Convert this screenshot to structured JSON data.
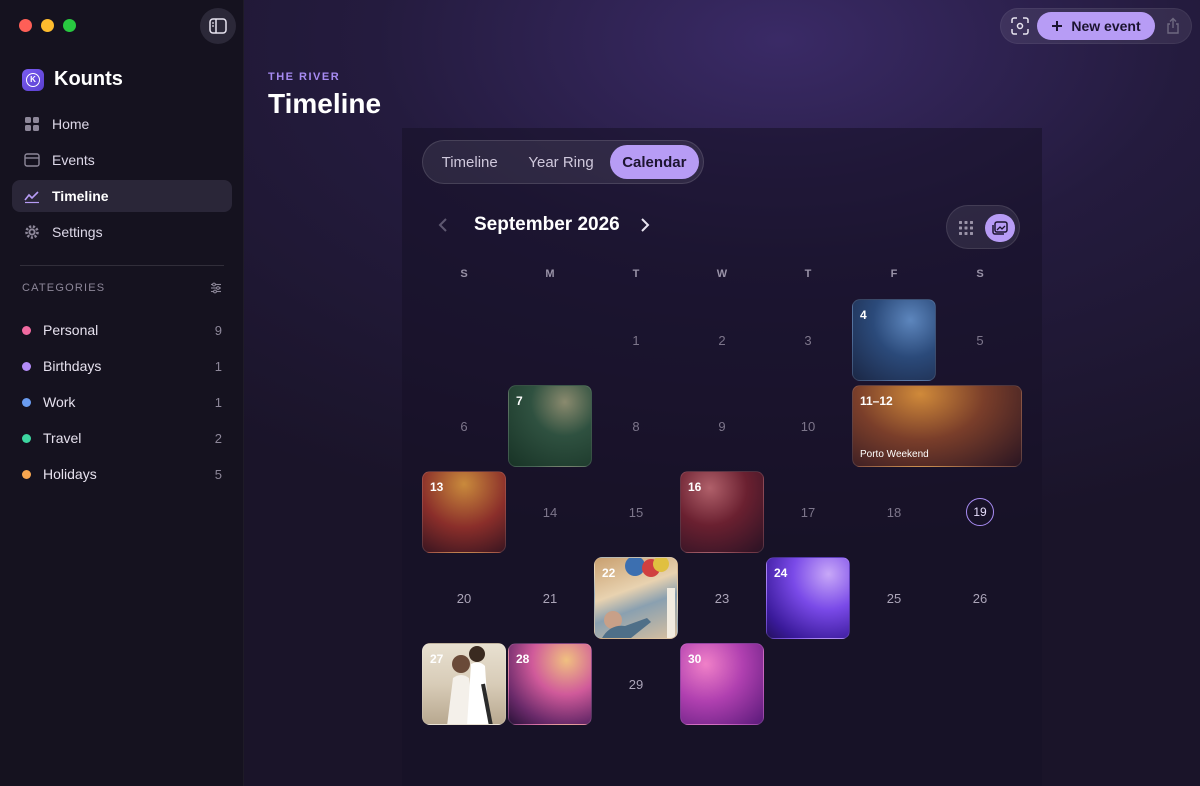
{
  "sidebar": {
    "brand": "Kounts",
    "nav": [
      {
        "label": "Home",
        "icon": "home-grid-icon"
      },
      {
        "label": "Events",
        "icon": "calendar-icon"
      },
      {
        "label": "Timeline",
        "icon": "chart-line-icon",
        "active": true
      },
      {
        "label": "Settings",
        "icon": "gear-icon"
      }
    ],
    "categories_header": "CATEGORIES",
    "categories": [
      {
        "label": "Personal",
        "count": "9",
        "color": "#f06aa0"
      },
      {
        "label": "Birthdays",
        "count": "1",
        "color": "#b48cf8"
      },
      {
        "label": "Work",
        "count": "1",
        "color": "#6a9cf0"
      },
      {
        "label": "Travel",
        "count": "2",
        "color": "#3dd6a0"
      },
      {
        "label": "Holidays",
        "count": "5",
        "color": "#f7a650"
      }
    ]
  },
  "toolbar": {
    "new_event": "New event"
  },
  "header": {
    "eyebrow": "THE RIVER",
    "title": "Timeline"
  },
  "segmented": {
    "tabs": [
      "Timeline",
      "Year Ring",
      "Calendar"
    ],
    "active": "Calendar"
  },
  "calendar": {
    "month": "September 2026",
    "weekdays": [
      "S",
      "M",
      "T",
      "W",
      "T",
      "F",
      "S"
    ],
    "plain_days": [
      "1",
      "2",
      "3",
      "5",
      "6",
      "8",
      "9",
      "10",
      "14",
      "15",
      "17",
      "18",
      "20",
      "21",
      "23",
      "25",
      "26",
      "29"
    ],
    "today": "19",
    "event_tiles": [
      {
        "label": "4"
      },
      {
        "label": "7"
      },
      {
        "label": "11–12",
        "caption": "Porto Weekend"
      },
      {
        "label": "13"
      },
      {
        "label": "16"
      },
      {
        "label": "22"
      },
      {
        "label": "24"
      },
      {
        "label": "27"
      },
      {
        "label": "28"
      },
      {
        "label": "30"
      }
    ]
  },
  "colors": {
    "accent": "#b79cf5",
    "accent_text": "#a78bf2"
  }
}
